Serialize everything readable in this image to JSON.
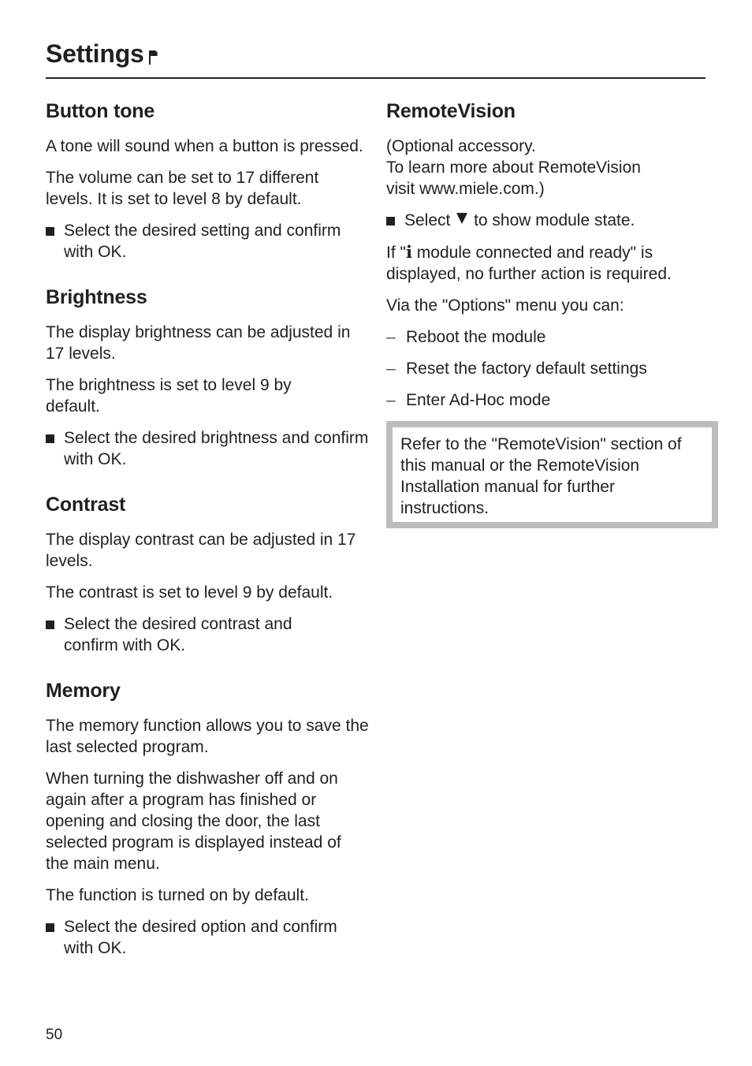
{
  "header": {
    "title": "Settings",
    "title_icon": "flag-icon"
  },
  "left_column": {
    "button_tone": {
      "heading": "Button tone",
      "paragraphs": [
        "A tone will sound when a button is pressed.",
        "The volume can be set to 17 different levels. It is set to level 8 by default."
      ],
      "bullet": "Select the desired setting and confirm with OK."
    },
    "brightness": {
      "heading": "Brightness",
      "paragraphs": [
        "The display brightness can be adjusted in 17 levels.",
        "The brightness is set to level 9 by default."
      ],
      "bullet": "Select the desired brightness and confirm with OK."
    },
    "contrast": {
      "heading": "Contrast",
      "paragraphs": [
        "The display contrast can be adjusted in 17 levels.",
        "The contrast is set to level 9 by default."
      ],
      "bullet": "Select the desired contrast and confirm with OK."
    },
    "memory": {
      "heading": "Memory",
      "paragraphs": [
        "The memory function allows you to save the last selected program.",
        "When turning the dishwasher off and on again after a program has finished or opening and closing the door, the last selected program is displayed instead of the main menu.",
        "The function is turned on by default."
      ],
      "bullet": "Select the desired option and confirm with OK."
    }
  },
  "right_column": {
    "remotevision": {
      "heading": "RemoteVision",
      "intro_line1": "(Optional accessory.",
      "intro_line2": "To learn more about RemoteVision visit www.miele.com.)",
      "bullet_prefix": "Select",
      "bullet_icon": "down-triangle-icon",
      "bullet_suffix": "to show module state.",
      "status_prefix": "If \"",
      "status_icon_glyph": "i",
      "status_suffix": " module connected and ready\" is displayed, no further action is required.",
      "options_intro": "Via the \"Options\" menu you can:",
      "options": [
        "Reboot the module",
        "Reset the factory default settings",
        "Enter Ad-Hoc mode"
      ],
      "note": "Refer to the \"RemoteVision\" section of this manual or the RemoteVision Installation manual for further instructions."
    }
  },
  "footer": {
    "page_number": "50"
  },
  "colors": {
    "text": "#231f20",
    "note_border": "#bcbcbc"
  }
}
